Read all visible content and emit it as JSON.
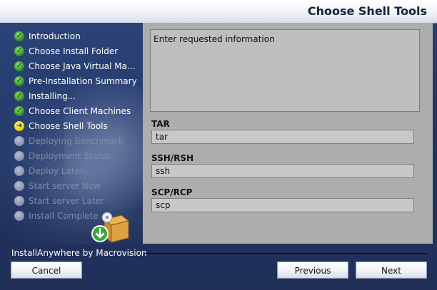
{
  "header": {
    "title": "Choose Shell Tools"
  },
  "sidebar": {
    "steps": [
      {
        "label": "Introduction",
        "state": "done"
      },
      {
        "label": "Choose Install Folder",
        "state": "done"
      },
      {
        "label": "Choose Java Virtual Ma...",
        "state": "done"
      },
      {
        "label": "Pre-Installation Summary",
        "state": "done"
      },
      {
        "label": "Installing...",
        "state": "done"
      },
      {
        "label": "Choose Client Machines",
        "state": "done"
      },
      {
        "label": "Choose Shell Tools",
        "state": "current"
      },
      {
        "label": "Deploying Benchmark",
        "state": "pending"
      },
      {
        "label": "Deployment Status",
        "state": "pending"
      },
      {
        "label": "Deploy Later",
        "state": "pending"
      },
      {
        "label": "Start server Now",
        "state": "pending"
      },
      {
        "label": "Start server Later",
        "state": "pending"
      },
      {
        "label": "Install Complete",
        "state": "pending"
      }
    ]
  },
  "main": {
    "info_text": "Enter requested information",
    "fields": [
      {
        "label": "TAR",
        "value": "tar"
      },
      {
        "label": "SSH/RSH",
        "value": "ssh"
      },
      {
        "label": "SCP/RCP",
        "value": "scp"
      }
    ]
  },
  "footer": {
    "vendor": "InstallAnywhere by Macrovision",
    "cancel": "Cancel",
    "previous": "Previous",
    "next": "Next"
  },
  "icons": {
    "done": "check-icon",
    "current": "arrow-right-icon",
    "pending": "circle-icon"
  }
}
